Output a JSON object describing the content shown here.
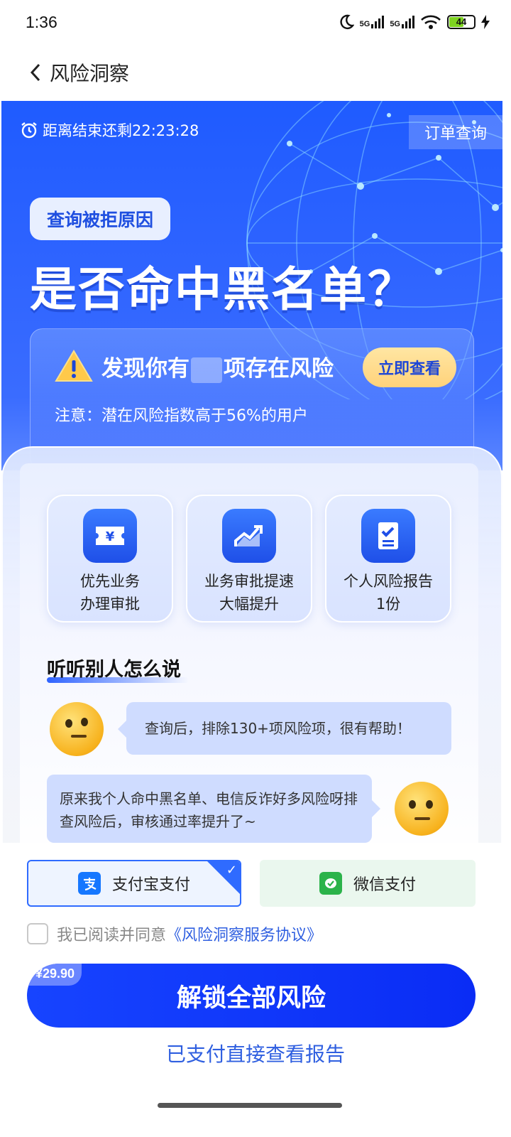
{
  "status_bar": {
    "time": "1:36",
    "sig1": "5G",
    "sig2": "5G",
    "battery": "44"
  },
  "nav": {
    "back_icon": "chevron-left-icon",
    "title": "风险洞察"
  },
  "hero": {
    "countdown": "距离结束还剩22:23:28",
    "order_query": "订单查询",
    "reason_tag": "查询被拒原因",
    "headline": "是否命中黑名单？",
    "risk_prefix": "发现你有",
    "risk_suffix": "项存在风险",
    "view_now": "立即查看",
    "note": "注意：潜在风险指数高于56%的用户"
  },
  "benefits": [
    {
      "icon": "yen-ticket-icon",
      "line1": "优先业务",
      "line2": "办理审批"
    },
    {
      "icon": "trend-up-icon",
      "line1": "业务审批提速",
      "line2": "大幅提升"
    },
    {
      "icon": "report-check-icon",
      "line1": "个人风险报告",
      "line2": "1份"
    }
  ],
  "testimonials": {
    "title": "听听别人怎么说",
    "items": [
      {
        "avatar": "thinking-emoji-icon",
        "text": "查询后，排除130+项风险项，很有帮助！"
      },
      {
        "avatar": "monocle-emoji-icon",
        "text": "原来我个人命中黑名单、电信反诈好多风险呀排查风险后，审核通过率提升了~"
      }
    ]
  },
  "payment": {
    "alipay": "支付宝支付",
    "wechat": "微信支付",
    "selected": "alipay"
  },
  "agreement": {
    "prefix": "我已阅读并同意",
    "link": "《风险洞察服务协议》"
  },
  "cta": {
    "price": "¥29.90",
    "label": "解锁全部风险"
  },
  "paid_link": "已支付直接查看报告",
  "colors": {
    "primary": "#1f5bff",
    "link": "#2f5fe0",
    "accent_gold": "#ffd27a"
  }
}
